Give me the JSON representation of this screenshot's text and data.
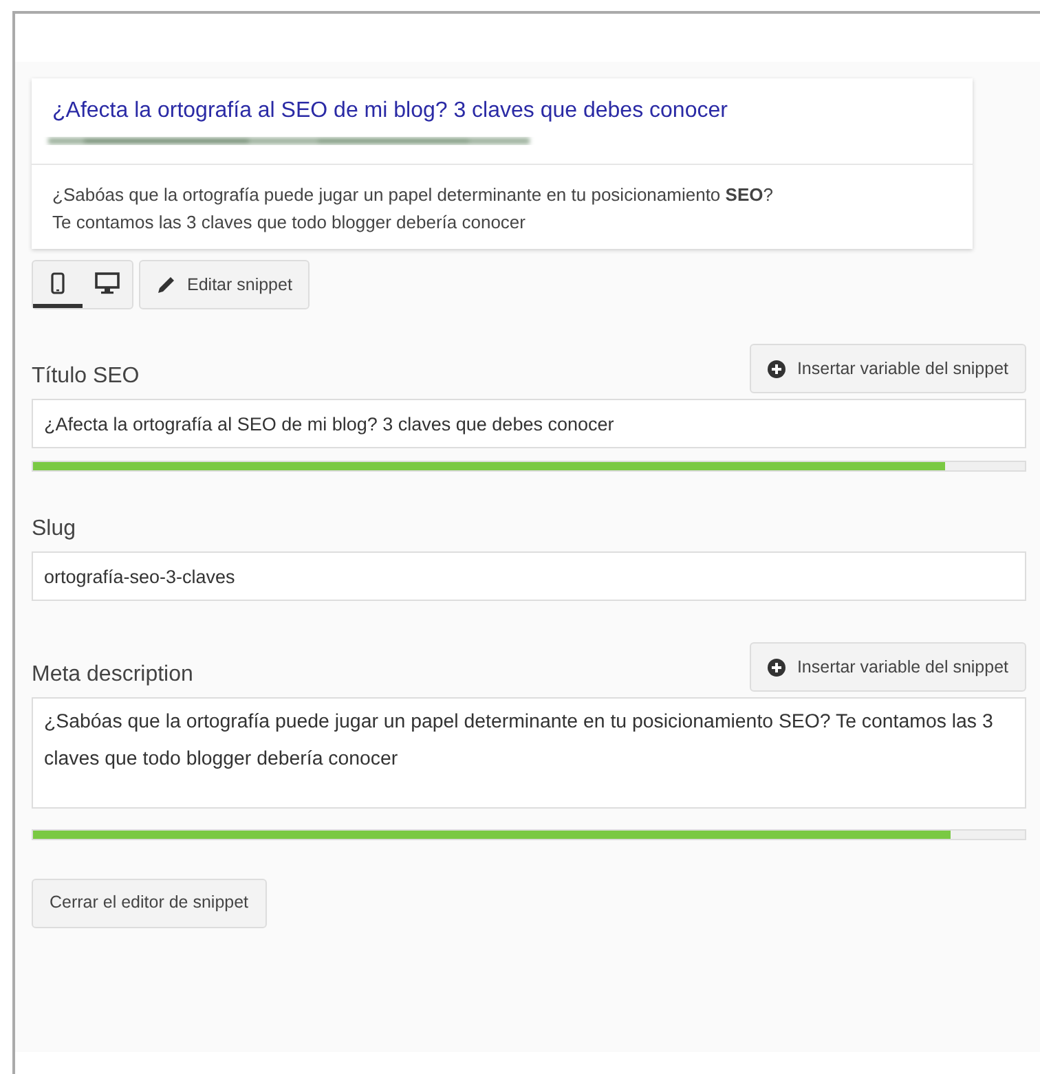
{
  "preview": {
    "title": "¿Afecta la ortografía al SEO de mi blog? 3 claves que debes conocer",
    "url_redacted": true,
    "description": "¿Sabóas que la ortografía puede jugar un papel determinante en tu posicionamiento **SEO**?\nTe contamos las 3 claves que todo blogger debería conocer"
  },
  "devices": [
    {
      "kind": "mobile",
      "selected": true
    },
    {
      "kind": "desktop",
      "selected": false
    }
  ],
  "edit_button": "Editar snippet",
  "fields": [
    {
      "kind": "input",
      "label": "Título SEO",
      "insert_button": "Insertar variable del snippet",
      "value": "¿Afecta la ortografía al SEO de mi blog? 3 claves que debes conocer",
      "level": 0.92
    },
    {
      "kind": "input",
      "label": "Slug",
      "value": "ortografía-seo-3-claves"
    },
    {
      "kind": "textarea",
      "label": "Meta description",
      "insert_button": "Insertar variable del snippet",
      "value": "¿Sabóas que la ortografía puede jugar un papel determinante en tu posicionamiento SEO? Te contamos las 3 claves que todo blogger debería conocer",
      "level": 0.925
    }
  ],
  "close_button": "Cerrar el editor de snippet"
}
